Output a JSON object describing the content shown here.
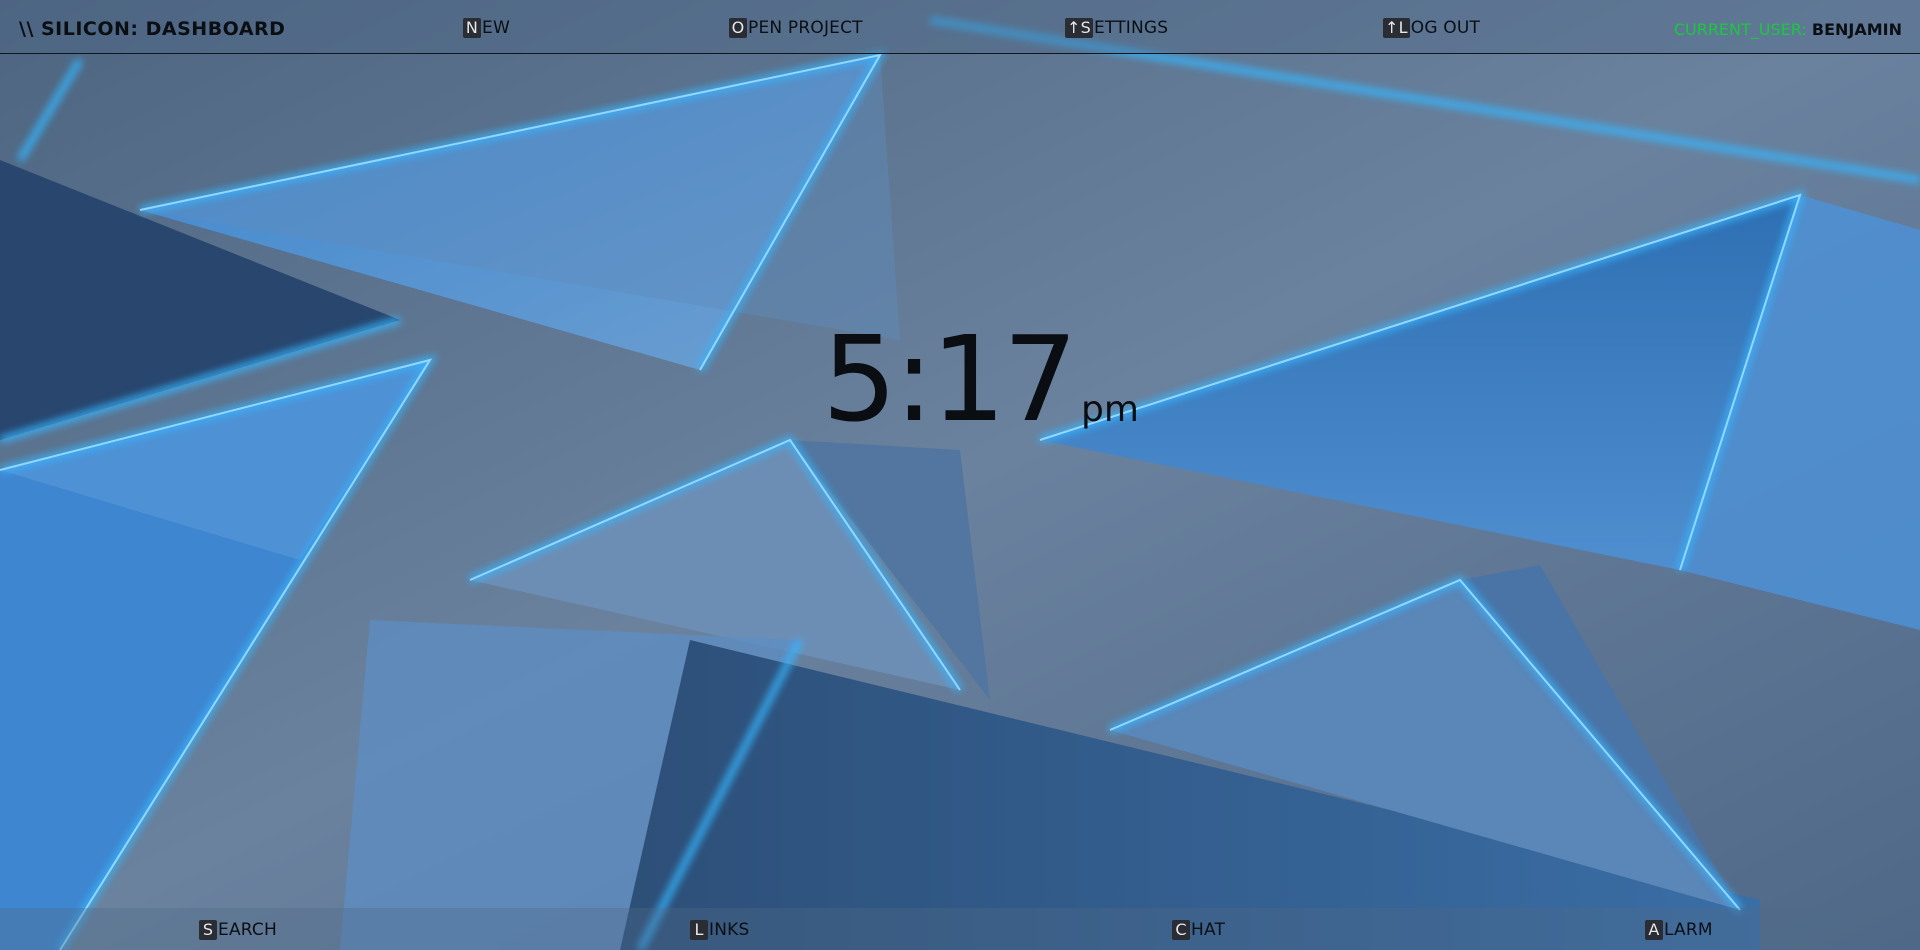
{
  "colors": {
    "background": "#5b7390",
    "accent_blue": "#1e8fe6",
    "user_label": "#19c93e",
    "text_dark": "#0b0f14",
    "key_bg": "#2a2d33"
  },
  "header": {
    "title": "\\\\ SILICON: DASHBOARD",
    "menu": [
      {
        "key": "N",
        "rest": "EW"
      },
      {
        "key": "O",
        "rest": "PEN PROJECT"
      },
      {
        "key": "↑S",
        "rest": "ETTINGS"
      },
      {
        "key": "↑L",
        "rest": "OG OUT"
      }
    ],
    "user_label": "CURRENT_USER:",
    "user_name": "BENJAMIN"
  },
  "clock": {
    "time": "5:17",
    "ampm": "pm"
  },
  "footer": {
    "menu": [
      {
        "key": "S",
        "rest": "EARCH"
      },
      {
        "key": "L",
        "rest": "INKS"
      },
      {
        "key": "C",
        "rest": "HAT"
      },
      {
        "key": "A",
        "rest": "LARM"
      }
    ]
  }
}
